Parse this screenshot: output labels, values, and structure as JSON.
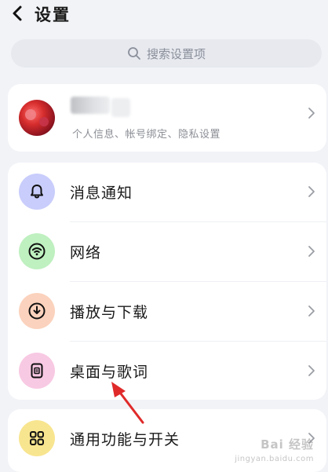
{
  "header": {
    "title": "设置",
    "back_icon": "chevron-left-icon"
  },
  "search": {
    "placeholder": "搜索设置项",
    "icon": "search-icon"
  },
  "profile": {
    "subtitle": "个人信息、帐号绑定、隐私设置"
  },
  "menu": [
    {
      "label": "消息通知",
      "icon": "bell-icon",
      "color": "#c9cdfb"
    },
    {
      "label": "网络",
      "icon": "wifi-icon",
      "color": "#bff0c0"
    },
    {
      "label": "播放与下载",
      "icon": "download-icon",
      "color": "#fbd2bd"
    },
    {
      "label": "桌面与歌词",
      "icon": "lyrics-widget-icon",
      "color": "#f8c9e3"
    }
  ],
  "menu2": [
    {
      "label": "通用功能与开关",
      "icon": "grid-icon",
      "color": "#f8e58f"
    }
  ],
  "watermark": {
    "main": "Bai 经验",
    "sub": "jingyan.baidu.com"
  }
}
